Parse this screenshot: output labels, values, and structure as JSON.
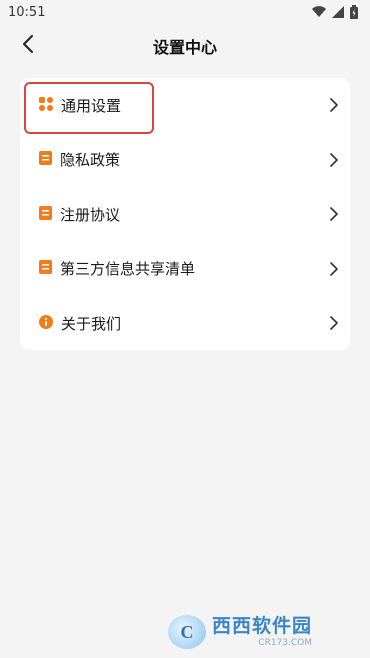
{
  "status_bar": {
    "time": "10:51",
    "icons": [
      "wifi-icon",
      "signal-icon",
      "battery-charging-icon"
    ]
  },
  "header": {
    "title": "设置中心",
    "back_icon": "chevron-left-icon"
  },
  "menu": {
    "items": [
      {
        "label": "通用设置",
        "icon": "grid-icon",
        "highlighted": true
      },
      {
        "label": "隐私政策",
        "icon": "document-icon"
      },
      {
        "label": "注册协议",
        "icon": "document-icon"
      },
      {
        "label": "第三方信息共享清单",
        "icon": "document-icon"
      },
      {
        "label": "关于我们",
        "icon": "info-icon"
      }
    ]
  },
  "watermark": {
    "name": "西西软件园",
    "sub": "CR173.COM",
    "logo_letter": "C"
  },
  "colors": {
    "accent": "#f07d1a",
    "highlight_border": "#d8473b",
    "background": "#f4f4f4"
  }
}
